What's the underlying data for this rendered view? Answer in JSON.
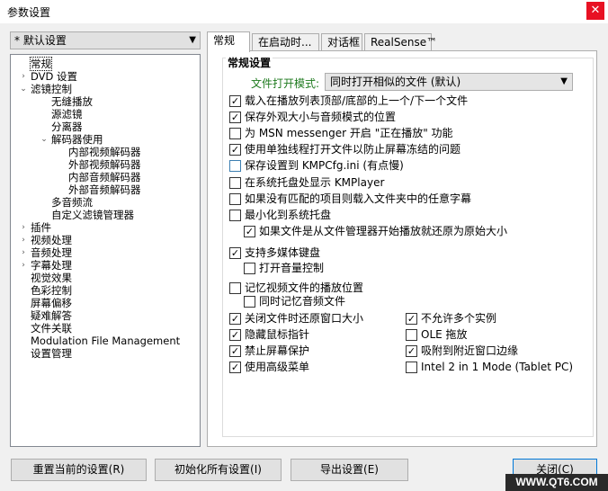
{
  "window": {
    "title": "参数设置",
    "close_glyph": "✕"
  },
  "preset": {
    "value": "* 默认设置"
  },
  "tree": [
    {
      "label": "常规",
      "exp": "",
      "selected": true
    },
    {
      "label": "DVD 设置",
      "exp": "+"
    },
    {
      "label": "滤镜控制",
      "exp": "−"
    },
    {
      "label": "无缝播放",
      "exp": ""
    },
    {
      "label": "源滤镜",
      "exp": ""
    },
    {
      "label": "分离器",
      "exp": ""
    },
    {
      "label": "解码器使用",
      "exp": "−"
    },
    {
      "label": "内部视频解码器",
      "exp": ""
    },
    {
      "label": "外部视频解码器",
      "exp": ""
    },
    {
      "label": "内部音频解码器",
      "exp": ""
    },
    {
      "label": "外部音频解码器",
      "exp": ""
    },
    {
      "label": "多音频流",
      "exp": ""
    },
    {
      "label": "自定义滤镜管理器",
      "exp": ""
    },
    {
      "label": "插件",
      "exp": "+"
    },
    {
      "label": "视频处理",
      "exp": "+"
    },
    {
      "label": "音频处理",
      "exp": "+"
    },
    {
      "label": "字幕处理",
      "exp": "+"
    },
    {
      "label": "视觉效果",
      "exp": ""
    },
    {
      "label": "色彩控制",
      "exp": ""
    },
    {
      "label": "屏幕偏移",
      "exp": ""
    },
    {
      "label": "疑难解答",
      "exp": ""
    },
    {
      "label": "文件关联",
      "exp": ""
    },
    {
      "label": "Modulation File Management",
      "exp": ""
    },
    {
      "label": "设置管理",
      "exp": ""
    }
  ],
  "tabs": [
    "常规",
    "在启动时...",
    "对话框",
    "RealSense™"
  ],
  "group_title": "常规设置",
  "open_mode": {
    "label": "文件打开模式:",
    "value": "同时打开相似的文件 (默认)"
  },
  "options": [
    {
      "label": "载入在播放列表顶部/底部的上一个/下一个文件",
      "checked": true
    },
    {
      "label": "保存外观大小与音频模式的位置",
      "checked": true
    },
    {
      "label": "为 MSN messenger 开启 \"正在播放\" 功能",
      "checked": false
    },
    {
      "label": "使用单独线程打开文件以防止屏幕冻结的问题",
      "checked": true
    },
    {
      "label": "保存设置到 KMPCfg.ini (有点慢)",
      "checked": false
    },
    {
      "label": "在系统托盘处显示 KMPlayer",
      "checked": false
    },
    {
      "label": "如果没有匹配的项目则载入文件夹中的任意字幕",
      "checked": false
    },
    {
      "label": "最小化到系统托盘",
      "checked": false
    },
    {
      "label": "如果文件是从文件管理器开始播放就还原为原始大小",
      "checked": true
    },
    {
      "label": "支持多媒体键盘",
      "checked": true
    },
    {
      "label": "打开音量控制",
      "checked": false
    },
    {
      "label": "记忆视频文件的播放位置",
      "checked": false
    },
    {
      "label": "同时记忆音频文件",
      "checked": false
    },
    {
      "label": "关闭文件时还原窗口大小",
      "checked": true
    },
    {
      "label": "不允许多个实例",
      "checked": true
    },
    {
      "label": "隐藏鼠标指针",
      "checked": true
    },
    {
      "label": "OLE 拖放",
      "checked": false
    },
    {
      "label": "禁止屏幕保护",
      "checked": true
    },
    {
      "label": "吸附到附近窗口边缘",
      "checked": true
    },
    {
      "label": "使用高级菜单",
      "checked": true
    },
    {
      "label": "Intel 2 in 1 Mode (Tablet PC)",
      "checked": false
    }
  ],
  "buttons": {
    "reset": "重置当前的设置(R)",
    "init_all": "初始化所有设置(I)",
    "export": "导出设置(E)",
    "close": "关闭(C)"
  },
  "watermark": "WWW.QT6.COM"
}
